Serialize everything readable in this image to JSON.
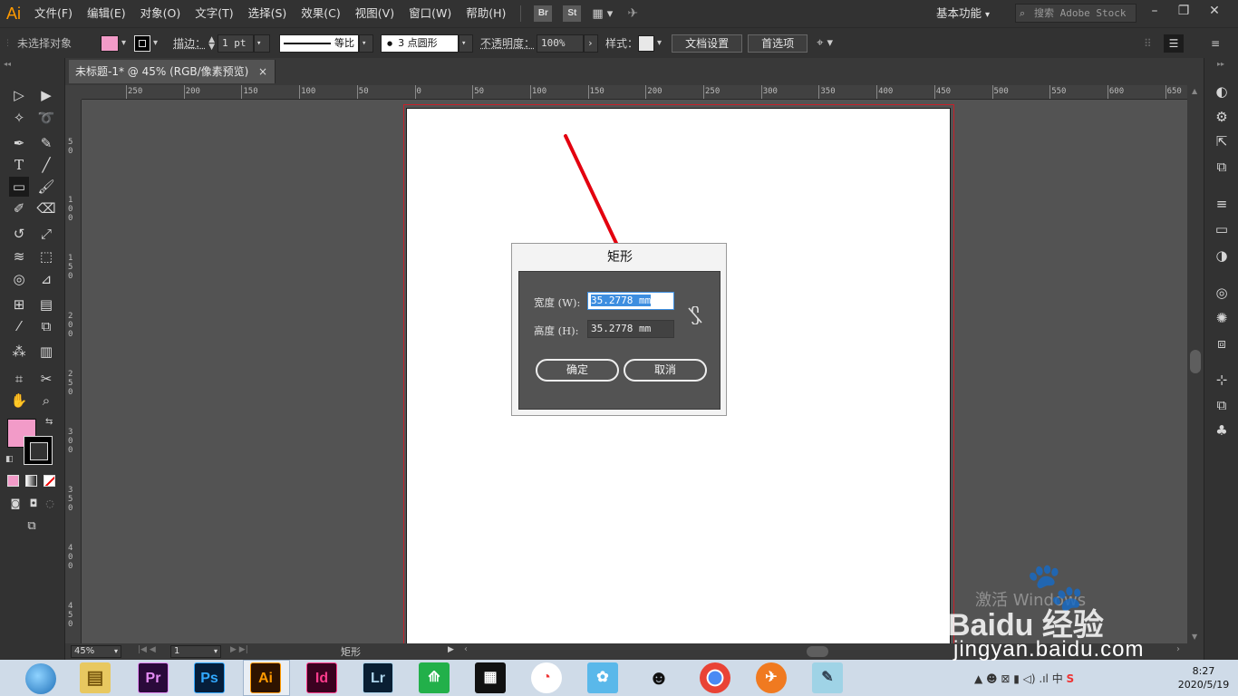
{
  "app": {
    "logo": "Ai",
    "menus": [
      "文件(F)",
      "编辑(E)",
      "对象(O)",
      "文字(T)",
      "选择(S)",
      "效果(C)",
      "视图(V)",
      "窗口(W)",
      "帮助(H)"
    ],
    "bridge": "Br",
    "stock": "St",
    "workspace": "基本功能",
    "search_placeholder": "搜索 Adobe Stock"
  },
  "control_bar": {
    "selection": "未选择对象",
    "fill_color": "#f29bc8",
    "stroke_label": "描边：",
    "stroke_weight": "1 pt",
    "stroke_profile": "等比",
    "brush": "3 点圆形",
    "opacity_label": "不透明度：",
    "opacity": "100%",
    "style_label": "样式：",
    "doc_setup": "文档设置",
    "preferences": "首选项"
  },
  "document": {
    "tab_title": "未标题-1* @ 45% (RGB/像素预览)",
    "close": "×"
  },
  "ruler": {
    "h_labels": [
      "250",
      "200",
      "150",
      "100",
      "50",
      "0",
      "50",
      "100",
      "150",
      "200",
      "250",
      "300",
      "350",
      "400",
      "450",
      "500",
      "550",
      "600",
      "650"
    ],
    "v_labels": [
      "50",
      "100",
      "150",
      "200",
      "250",
      "300",
      "350",
      "400",
      "450"
    ]
  },
  "dialog": {
    "title": "矩形",
    "width_label": "宽度 (W):",
    "width_value": "35.2778 mm",
    "height_label": "高度 (H):",
    "height_value": "35.2778 mm",
    "ok": "确定",
    "cancel": "取消"
  },
  "status": {
    "zoom": "45%",
    "artboard": "1",
    "tool": "矩形"
  },
  "taskbar": {
    "apps": [
      "Pr",
      "Ps",
      "Ai",
      "Id",
      "Lr"
    ],
    "ime": "中",
    "time": "8:27",
    "date": "2020/5/19"
  },
  "watermark": {
    "activate": "激活 Windows",
    "site": "jingyan.baidu.com",
    "brand": "Baidu 经验"
  }
}
